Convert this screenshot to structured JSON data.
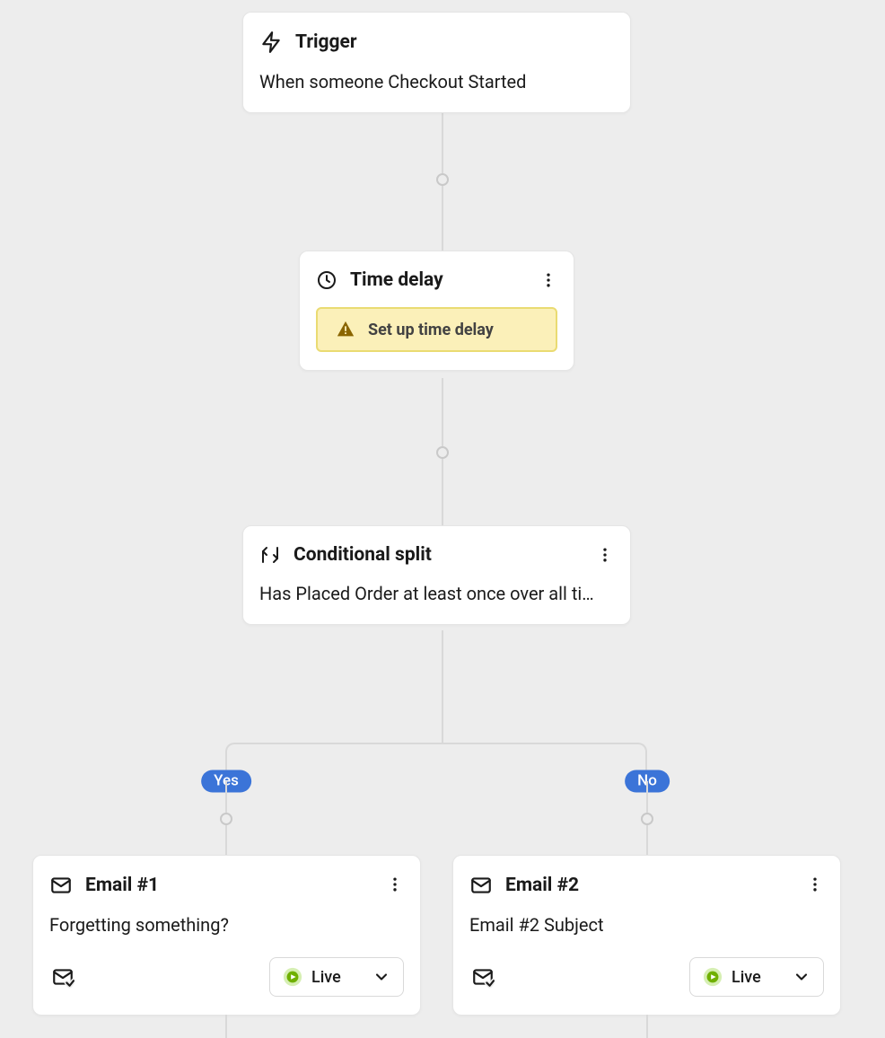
{
  "trigger": {
    "title": "Trigger",
    "desc": "When someone Checkout Started"
  },
  "time_delay": {
    "title": "Time delay",
    "warn": "Set up time delay"
  },
  "conditional": {
    "title": "Conditional split",
    "desc": "Has Placed Order at least once over all ti…"
  },
  "branches": {
    "yes": "Yes",
    "no": "No"
  },
  "email1": {
    "title": "Email #1",
    "desc": "Forgetting something?",
    "status": "Live"
  },
  "email2": {
    "title": "Email #2",
    "desc": "Email #2 Subject",
    "status": "Live"
  },
  "colors": {
    "pill": "#3b74d8",
    "warn_bg": "#fbf0b9",
    "warn_border": "#eadb72",
    "play_green": "#6fb000"
  }
}
